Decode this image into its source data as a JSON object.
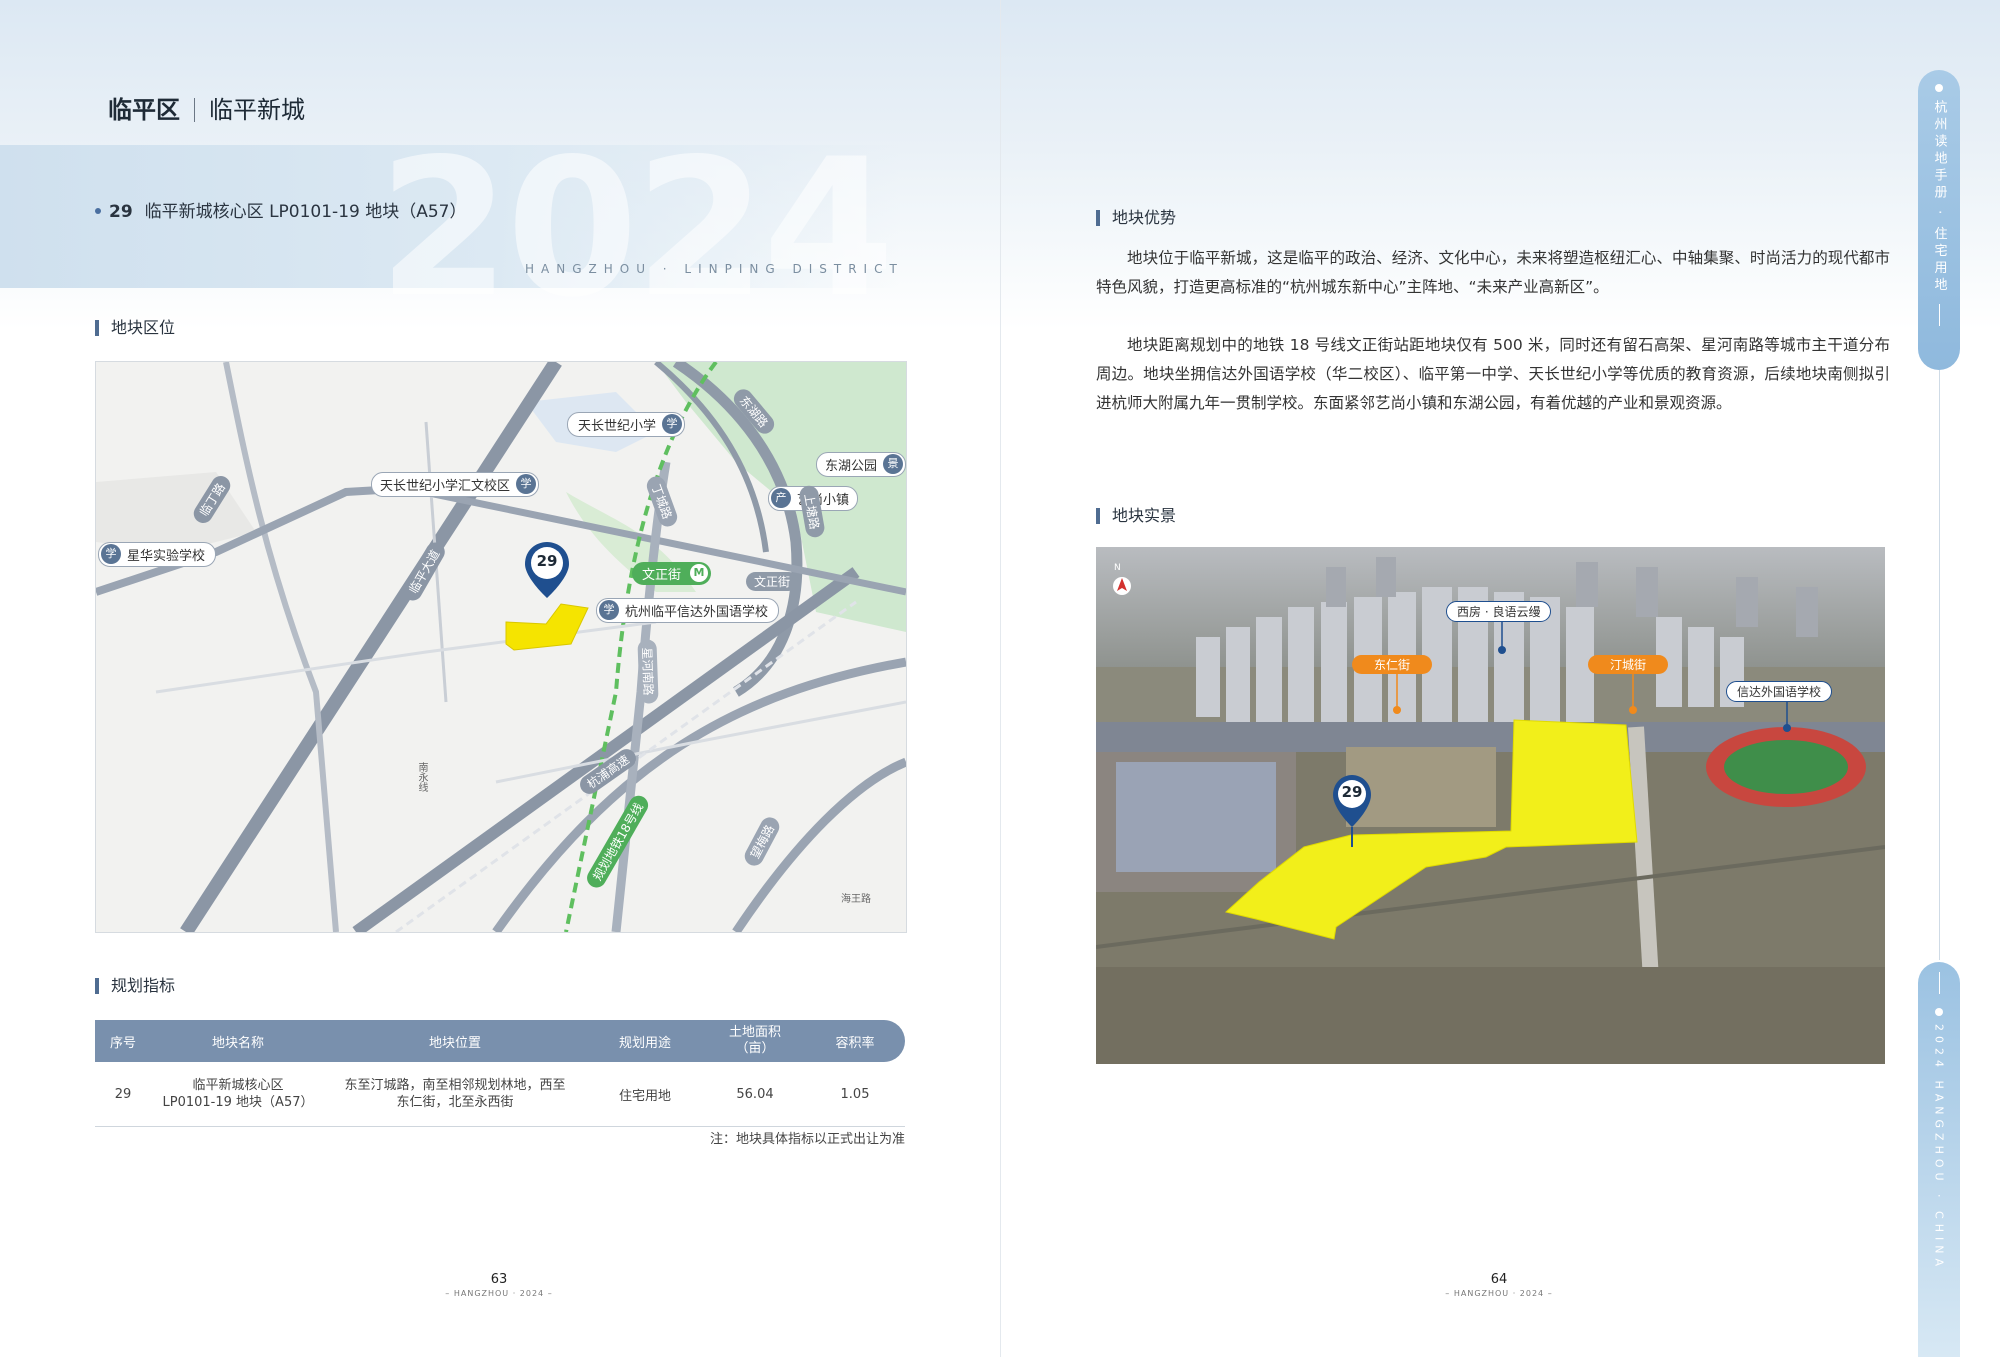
{
  "header": {
    "district": "临平区",
    "subarea": "临平新城",
    "year_watermark": "2024",
    "district_en": "HANGZHOU · LINPING DISTRICT"
  },
  "plot": {
    "number": "29",
    "title": "临平新城核心区 LP0101-19 地块（A57）"
  },
  "sections": {
    "location": "地块区位",
    "indicators": "规划指标",
    "advantages": "地块优势",
    "photo": "地块实景"
  },
  "map_labels": {
    "pin": "29",
    "school1": "天长世纪小学",
    "school2": "天长世纪小学汇文校区",
    "school3": "星华实验学校",
    "school4": "杭州临平信达外国语学校",
    "park": "东湖公园",
    "town": "艺尚小镇",
    "station": "文正街",
    "road_wenzheng": "文正街",
    "road_linding": "临丁路",
    "road_xinghe": "星河南路",
    "road_lintai": "临平大道",
    "road_dingcheng": "丁城路",
    "road_donghu": "东湖路",
    "road_haiwang": "上塘路",
    "road_hangpu": "杭浦高速",
    "road_metro": "规划地铁18号线",
    "road_shangtang": "望梅路",
    "road_haitang": "海王路",
    "road_nanyong": "南永线",
    "icon_xue": "学",
    "icon_chan": "产",
    "icon_jing": "景"
  },
  "table": {
    "headers": [
      "序号",
      "地块名称",
      "地块位置",
      "规划用途",
      "土地面积（亩）",
      "容积率"
    ],
    "row": {
      "no": "29",
      "name_l1": "临平新城核心区",
      "name_l2": "LP0101-19 地块（A57）",
      "loc_l1": "东至汀城路，南至相邻规划林地，西至",
      "loc_l2": "东仁街，北至永西街",
      "use": "住宅用地",
      "area": "56.04",
      "far": "1.05"
    },
    "note": "注：地块具体指标以正式出让为准"
  },
  "paragraphs": {
    "p1": "地块位于临平新城，这是临平的政治、经济、文化中心，未来将塑造枢纽汇心、中轴集聚、时尚活力的现代都市特色风貌，打造更高标准的“杭州城东新中心”主阵地、“未来产业高新区”。",
    "p2": "地块距离规划中的地铁 18 号线文正街站距地块仅有 500 米，同时还有留石高架、星河南路等城市主干道分布周边。地块坐拥信达外国语学校（华二校区）、临平第一中学、天长世纪小学等优质的教育资源，后续地块南侧拟引进杭师大附属九年一贯制学校。东面紧邻艺尚小镇和东湖公园，有着优越的产业和景观资源。"
  },
  "photo_labels": {
    "pin": "29",
    "north": "N",
    "community": "西房 · 良语云缦",
    "street_w": "东仁街",
    "street_e": "汀城街",
    "school": "信达外国语学校"
  },
  "pages": {
    "left": "63",
    "right": "64",
    "sub": "– HANGZHOU · 2024 –"
  },
  "side_tabs": {
    "top": "杭州读地手册 · 住宅用地",
    "bottom": "2024 HANGZHOU · CHINA"
  },
  "colors": {
    "accent": "#4f6c91",
    "plot_yellow": "#f5e400",
    "table_head": "#7990ad",
    "side_tab": "#9bc2e2",
    "label_orange": "#f08a1c"
  }
}
